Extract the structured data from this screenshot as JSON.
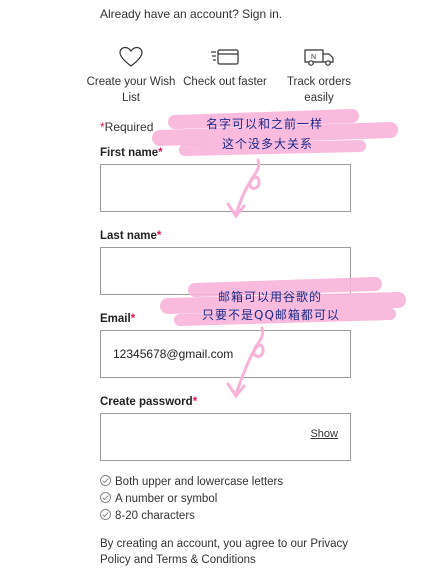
{
  "header": {
    "signin_text": "Already have an account? Sign in."
  },
  "benefits": [
    {
      "icon": "heart-icon",
      "label": "Create your Wish List"
    },
    {
      "icon": "card-icon",
      "label": "Check out faster"
    },
    {
      "icon": "delivery-truck-icon",
      "label": "Track orders easily"
    }
  ],
  "form": {
    "required_note": "Required",
    "first_name": {
      "label": "First name",
      "value": ""
    },
    "last_name": {
      "label": "Last name",
      "value": ""
    },
    "email": {
      "label": "Email",
      "value": "12345678@gmail.com"
    },
    "password": {
      "label": "Create password",
      "value": "",
      "show_label": "Show"
    },
    "password_rules": [
      "Both upper and lowercase letters",
      "A number or symbol",
      "8-20 characters"
    ],
    "terms_text": "By creating an account, you agree to our Privacy Policy and Terms & Conditions"
  },
  "annotations": {
    "note1_line1": "名字可以和之前一样",
    "note1_line2": "这个没多大关系",
    "note2_line1": "邮箱可以用谷歌的",
    "note2_line2": "只要不是QQ邮箱都可以"
  },
  "colors": {
    "accent": "#d4145a",
    "highlight": "#f7b3d9",
    "note_text": "#1e2a86"
  }
}
